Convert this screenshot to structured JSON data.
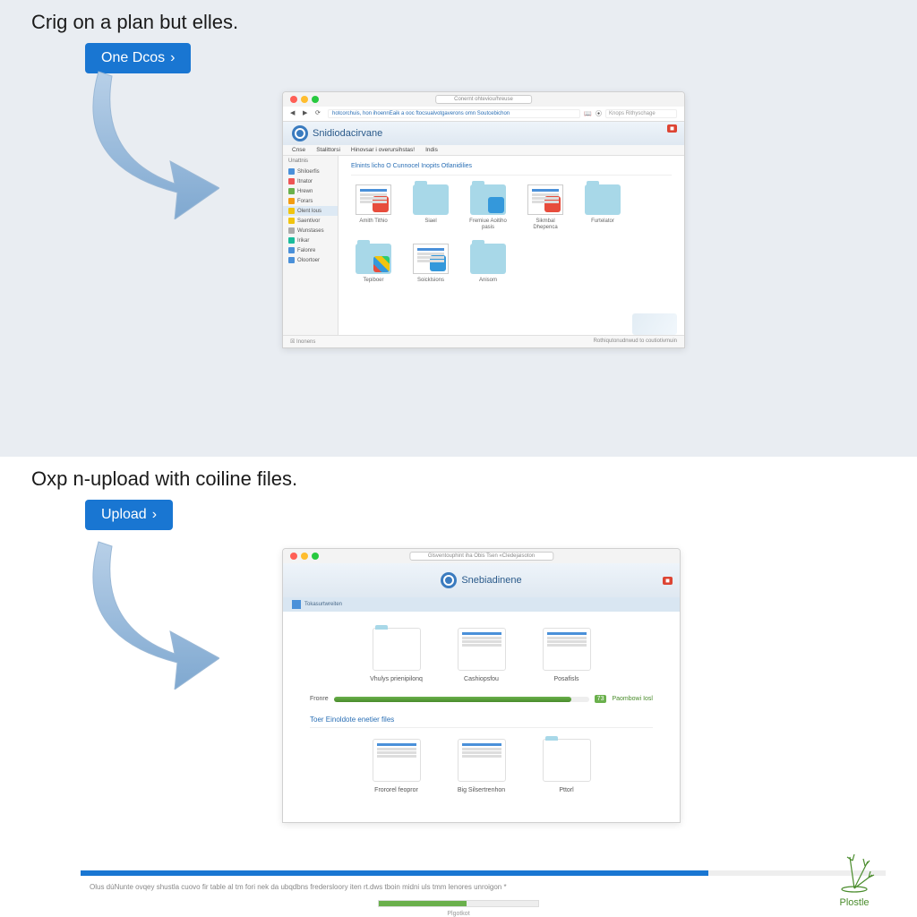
{
  "section1": {
    "headline": "Crig on a plan but elles.",
    "cta": "One Dcos",
    "browser": {
      "tab_title": "Conernt ohteviou/hreuse",
      "url": "hotcorchuis, hon ihoennEaik a ooc ftocsualvotgaverons omn Soutcebichon",
      "search_placeholder": "Knops Rithyschage",
      "brand": "Snidiodacirvane",
      "menubar": [
        "Cnse",
        "Stalittorsi",
        "Hinovsar i overursihstas!",
        "Indis"
      ],
      "sidebar_header": "Unattnis",
      "sidebar_items": [
        {
          "ico": "blue",
          "label": "Shiloerfis"
        },
        {
          "ico": "red",
          "label": "Itnator"
        },
        {
          "ico": "green",
          "label": "Hrewn"
        },
        {
          "ico": "orange",
          "label": "Forars"
        },
        {
          "ico": "gold",
          "label": "Olent lous",
          "active": true
        },
        {
          "ico": "gold",
          "label": "Saentivor"
        },
        {
          "ico": "gray",
          "label": "Wunstases"
        },
        {
          "ico": "teal",
          "label": "Irikar"
        },
        {
          "ico": "blue",
          "label": "Falonre"
        },
        {
          "ico": "blue",
          "label": "Oloortoer"
        }
      ],
      "breadcrumb": "Elnints licho O Cunnocel Inopits Otlanidilies",
      "items": [
        {
          "type": "doc",
          "label": "Amith Tithio",
          "ov": "ov-red"
        },
        {
          "type": "folder",
          "label": "Siael",
          "ov": ""
        },
        {
          "type": "folder",
          "label": "Fremiue Aoitiho pasis",
          "ov": "ov-blue"
        },
        {
          "type": "doc",
          "label": "Sikmbal Dhepenca",
          "ov": "ov-red"
        },
        {
          "type": "folder",
          "label": "Furtelator",
          "ov": ""
        },
        {
          "type": "folder",
          "label": "Tepiboer",
          "ov": "ov-multi"
        },
        {
          "type": "doc",
          "label": "Soicklsions",
          "ov": "ov-blue"
        },
        {
          "type": "folder",
          "label": "Anisom",
          "ov": ""
        }
      ],
      "footer_left": "Inonens",
      "footer_right": "Rothiqutonudnwud to coutiotivmuin",
      "red_badge": "◼"
    }
  },
  "section2": {
    "headline": "Oxp n-upload with coiline files.",
    "cta": "Upload",
    "browser": {
      "tab_title": "Glsventouphint iha Obis Tsen «Cledejaisoton",
      "brand": "Snebiadinene",
      "toolbar_label": "Tokasurtwreiten",
      "row1": [
        {
          "type": "folder",
          "label": "Vhulys prienipilonq"
        },
        {
          "type": "doc",
          "label": "Cashiopsfou"
        },
        {
          "type": "doc",
          "label": "Posafisls"
        }
      ],
      "progress_label": "Fronre",
      "progress_pct": "73",
      "progress_link": "Paombowi Iosl",
      "divider": "Toer Einoldote enetier files",
      "row2": [
        {
          "type": "doc",
          "label": "Frororel feopror"
        },
        {
          "type": "doc",
          "label": "Big Silsertrenhon"
        },
        {
          "type": "folder",
          "label": "Pttorl"
        }
      ]
    }
  },
  "bottom_strip": {
    "text": "Olus dúNunte ovqey shustla cuovo fir table al tm fori nek da ubqdbns fredersloory iten rt.dws tboin midni uls tmm lenores unroigon *",
    "label": "Plgotkot"
  },
  "plostle_label": "Plostle"
}
